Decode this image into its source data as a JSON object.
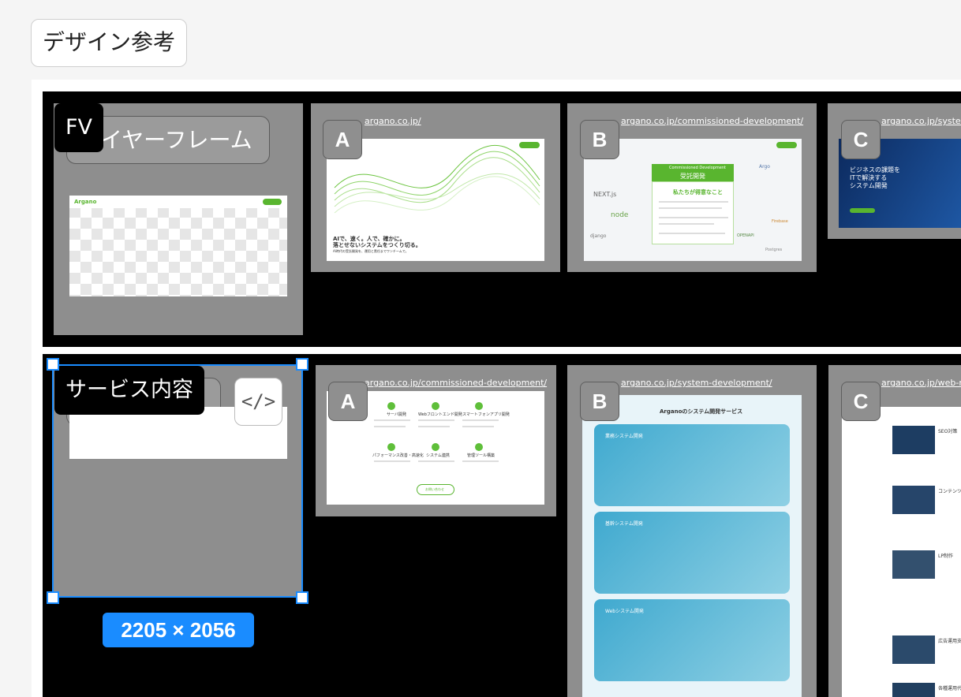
{
  "page_title": "デザイン参考",
  "sections": [
    {
      "label": "FV",
      "wireframe_label": "ワイヤーフレーム",
      "mock_brand": "Argano",
      "refs": [
        {
          "badge": "A",
          "url": "argano.co.jp/",
          "hero_line1": "AIで、速く。人で、確かに。",
          "hero_line2": "落とせないシステムをつくり切る。",
          "hero_line3": "AI時代の受託開発を、運用と責任までワンチームで。"
        },
        {
          "badge": "B",
          "url": "argano.co.jp/commissioned-development/",
          "en_title": "Commissioned Development",
          "jp_title": "受託開発",
          "sub": "私たちが得意なこと"
        },
        {
          "badge": "C",
          "url": "argano.co.jp/system-development/",
          "hero_line1": "ビジネスの課題を",
          "hero_line2": "ITで解決する",
          "hero_line3": "システム開発"
        }
      ]
    },
    {
      "label": "サービス内容",
      "code_icon": "</>",
      "dimensions": "2205 × 2056",
      "refs": [
        {
          "badge": "A",
          "url": "argano.co.jp/commissioned-development/",
          "items": [
            "サーバ開発",
            "Webフロントエンド開発",
            "スマートフォンアプリ開発",
            "パフォーマンス改善・高速化",
            "システム連携",
            "管理ツール構築"
          ],
          "button": "お問い合わせ"
        },
        {
          "badge": "B",
          "url": "argano.co.jp/system-development/",
          "heading": "Arganoのシステム開発サービス",
          "cards": [
            "業務システム開発",
            "基幹システム開発",
            "Webシステム開発"
          ]
        },
        {
          "badge": "C",
          "url": "argano.co.jp/web-marketing/",
          "items": [
            "SEO対策",
            "コンテンツマーケ",
            "LP制作",
            "広告運用支援",
            "各種運用代行"
          ]
        }
      ]
    }
  ],
  "colors": {
    "accent": "#1a8cff",
    "brand_green": "#59b52f"
  }
}
